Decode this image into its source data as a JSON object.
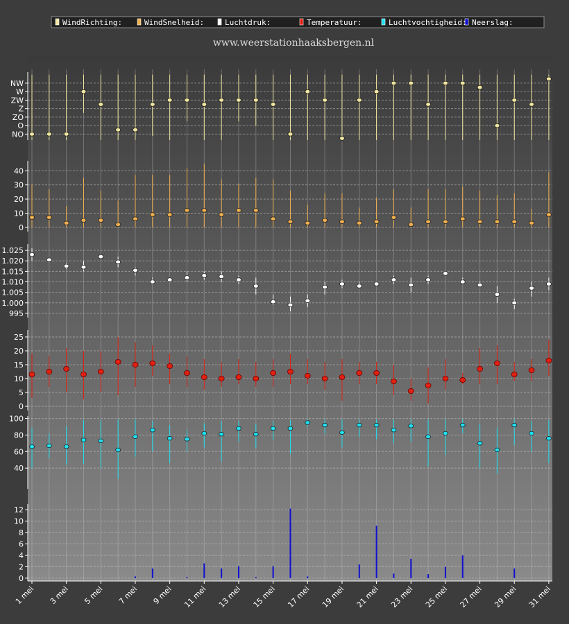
{
  "site_label": "www.weerstationhaaksbergen.nl",
  "legend": [
    {
      "label": "WindRichting:",
      "color": "#f0e6a0"
    },
    {
      "label": "WindSnelheid:",
      "color": "#f0b050"
    },
    {
      "label": "Luchtdruk:",
      "color": "#ffffff"
    },
    {
      "label": "Temperatuur:",
      "color": "#e02010"
    },
    {
      "label": "Luchtvochtigheid:",
      "color": "#20e0f0"
    },
    {
      "label": "Neerslag:",
      "color": "#1010d0"
    }
  ],
  "chart_data": [
    {
      "type": "scatter",
      "name": "WindRichting",
      "color": "#f0e6a0",
      "y_ticks": [
        "NO",
        "O",
        "ZO",
        "Z",
        "ZW",
        "W",
        "NW"
      ],
      "y_tick_values": [
        1,
        2,
        3,
        4,
        5,
        6,
        7
      ],
      "ylim": [
        0.3,
        8.3
      ],
      "x": [
        1,
        2,
        3,
        4,
        5,
        6,
        7,
        8,
        9,
        10,
        11,
        12,
        13,
        14,
        15,
        16,
        17,
        18,
        19,
        20,
        21,
        22,
        23,
        24,
        25,
        26,
        27,
        28,
        29,
        30,
        31
      ],
      "values": [
        1,
        1,
        1,
        6,
        4.5,
        1.5,
        1.5,
        4.5,
        5,
        5,
        4.5,
        5,
        5,
        5,
        4.5,
        1,
        6,
        5,
        0.5,
        5,
        6,
        7,
        7,
        4.5,
        7,
        7,
        6.5,
        2,
        5,
        4.5,
        7.5
      ],
      "low": [
        0.3,
        0.3,
        0.3,
        3.5,
        0.3,
        0.3,
        0.3,
        0.8,
        0.3,
        2.5,
        0.3,
        0.3,
        2.5,
        2,
        0.3,
        0.3,
        0.3,
        0.3,
        0.3,
        0.3,
        0.3,
        0.3,
        0.3,
        0.3,
        0.3,
        0.3,
        0.3,
        0.3,
        0.3,
        0.3,
        0.3
      ],
      "high": [
        8,
        8,
        8,
        8,
        8,
        8,
        8,
        8,
        8,
        8,
        8,
        8,
        8,
        8,
        8,
        8,
        8,
        8,
        8,
        8,
        8,
        8,
        8,
        8,
        8,
        8,
        8,
        8,
        8,
        8,
        8
      ]
    },
    {
      "type": "scatter",
      "name": "WindSnelheid",
      "color": "#f0b050",
      "y_ticks": [
        "0",
        "10",
        "20",
        "30",
        "40"
      ],
      "y_tick_values": [
        0,
        10,
        20,
        30,
        40
      ],
      "ylim": [
        -3,
        47
      ],
      "x": [
        1,
        2,
        3,
        4,
        5,
        6,
        7,
        8,
        9,
        10,
        11,
        12,
        13,
        14,
        15,
        16,
        17,
        18,
        19,
        20,
        21,
        22,
        23,
        24,
        25,
        26,
        27,
        28,
        29,
        30,
        31
      ],
      "values": [
        7,
        7,
        3,
        5,
        5,
        2,
        6,
        9,
        9,
        12,
        12,
        9,
        12,
        12,
        6,
        4,
        3,
        5,
        4,
        3,
        4,
        7,
        2,
        4,
        4,
        6,
        4,
        4,
        4,
        3,
        9
      ],
      "low": [
        0,
        0,
        0,
        0,
        0,
        0,
        0,
        0,
        0,
        0,
        0,
        0,
        0,
        0,
        0,
        0,
        0,
        0,
        0,
        0,
        0,
        0,
        0,
        0,
        0,
        0,
        0,
        0,
        0,
        0,
        0
      ],
      "high": [
        30,
        27,
        15,
        35,
        26,
        19,
        37,
        37,
        37,
        42,
        45,
        34,
        31,
        35,
        34,
        26,
        16,
        24,
        24,
        14,
        21,
        27,
        14,
        27,
        27,
        29,
        26,
        23,
        24,
        13,
        39
      ]
    },
    {
      "type": "scatter",
      "name": "Luchtdruk",
      "color": "#ffffff",
      "y_ticks": [
        "995",
        "1.000",
        "1.005",
        "1.010",
        "1.015",
        "1.020",
        "1.025"
      ],
      "y_tick_values": [
        995,
        1000,
        1005,
        1010,
        1015,
        1020,
        1025
      ],
      "ylim": [
        993,
        1028
      ],
      "x": [
        1,
        2,
        3,
        4,
        5,
        6,
        7,
        8,
        9,
        10,
        11,
        12,
        13,
        14,
        15,
        16,
        17,
        18,
        19,
        20,
        21,
        22,
        23,
        24,
        25,
        26,
        27,
        28,
        29,
        30,
        31
      ],
      "values": [
        1023,
        1020.5,
        1017.5,
        1017,
        1022,
        1019.5,
        1015.5,
        1010,
        1011,
        1012,
        1013,
        1012.5,
        1011,
        1008,
        1000.5,
        999,
        1001,
        1007.5,
        1009,
        1008,
        1009,
        1011,
        1008.5,
        1011,
        1014,
        1010,
        1008.5,
        1004,
        1000,
        1007,
        1009
      ],
      "low": [
        1020,
        1020,
        1016,
        1015,
        1021,
        1017,
        1013,
        1009,
        1010,
        1010,
        1011,
        1010,
        1009,
        1004,
        999,
        996,
        998,
        1004,
        1007,
        1007,
        1008,
        1009,
        1005,
        1009,
        1013,
        1009,
        1008,
        1000,
        997,
        1003,
        1006
      ],
      "high": [
        1026,
        1021,
        1019,
        1020,
        1023,
        1022,
        1017,
        1012,
        1012,
        1015,
        1015,
        1015,
        1013,
        1012,
        1004,
        1003,
        1004,
        1010,
        1011,
        1010,
        1010,
        1013,
        1012,
        1013,
        1015,
        1012,
        1010,
        1008,
        1002,
        1010,
        1012
      ]
    },
    {
      "type": "scatter",
      "name": "Temperatuur",
      "color": "#e02010",
      "y_ticks": [
        "0",
        "5",
        "10",
        "15",
        "20",
        "25"
      ],
      "y_tick_values": [
        0,
        5,
        10,
        15,
        20,
        25
      ],
      "ylim": [
        -1.5,
        27.5
      ],
      "x": [
        1,
        2,
        3,
        4,
        5,
        6,
        7,
        8,
        9,
        10,
        11,
        12,
        13,
        14,
        15,
        16,
        17,
        18,
        19,
        20,
        21,
        22,
        23,
        24,
        25,
        26,
        27,
        28,
        29,
        30,
        31
      ],
      "values": [
        11.5,
        12.5,
        13.5,
        11.5,
        12.5,
        16,
        15,
        15.5,
        14.5,
        12,
        10.5,
        10,
        10.5,
        10,
        12,
        12.5,
        11,
        10,
        10.5,
        12,
        12,
        9,
        5.5,
        7.5,
        10,
        9.5,
        13.5,
        15.5,
        11.5,
        13,
        16.5
      ],
      "low": [
        3,
        7,
        5,
        2.5,
        5,
        4,
        7,
        11,
        8,
        7,
        6,
        7,
        8,
        7,
        7,
        8,
        8,
        6,
        2,
        8,
        8,
        4,
        2,
        1,
        6,
        8,
        8,
        8,
        9,
        9,
        11
      ],
      "high": [
        19,
        18,
        21,
        20,
        20,
        25,
        23,
        22,
        19,
        18,
        17,
        16,
        17,
        16,
        17,
        19,
        17,
        16,
        17,
        16,
        16,
        15,
        10,
        14,
        17,
        12,
        21,
        22,
        16,
        17,
        24
      ]
    },
    {
      "type": "scatter",
      "name": "Luchtvochtigheid",
      "color": "#20e0f0",
      "y_ticks": [
        "40",
        "60",
        "80",
        "100"
      ],
      "y_tick_values": [
        40,
        60,
        80,
        100
      ],
      "ylim": [
        15,
        103
      ],
      "x": [
        1,
        2,
        3,
        4,
        5,
        6,
        7,
        8,
        9,
        10,
        11,
        12,
        13,
        14,
        15,
        16,
        17,
        18,
        19,
        20,
        21,
        22,
        23,
        24,
        25,
        26,
        27,
        28,
        29,
        30,
        31
      ],
      "values": [
        66,
        67,
        66,
        74,
        73,
        62,
        78,
        86,
        76,
        75,
        82,
        81,
        88,
        81,
        88,
        88,
        95,
        92,
        83,
        92,
        92,
        86,
        91,
        78,
        82,
        92,
        70,
        62,
        92,
        82,
        76
      ],
      "low": [
        40,
        52,
        44,
        45,
        40,
        27,
        54,
        60,
        46,
        60,
        65,
        48,
        72,
        64,
        74,
        57,
        90,
        82,
        65,
        78,
        75,
        70,
        72,
        42,
        56,
        82,
        40,
        33,
        68,
        60,
        46
      ],
      "high": [
        89,
        82,
        91,
        98,
        98,
        99,
        99,
        97,
        92,
        86,
        94,
        97,
        97,
        93,
        97,
        98,
        99,
        99,
        99,
        99,
        99,
        99,
        99,
        99,
        99,
        99,
        93,
        89,
        99,
        97,
        98
      ]
    },
    {
      "type": "bar",
      "name": "Neerslag",
      "color": "#1010d0",
      "y_ticks": [
        "0",
        "2",
        "4",
        "6",
        "8",
        "10",
        "12"
      ],
      "y_tick_values": [
        0,
        2,
        4,
        6,
        8,
        10,
        12
      ],
      "ylim": [
        -0.5,
        13
      ],
      "x": [
        1,
        2,
        3,
        4,
        5,
        6,
        7,
        8,
        9,
        10,
        11,
        12,
        13,
        14,
        15,
        16,
        17,
        18,
        19,
        20,
        21,
        22,
        23,
        24,
        25,
        26,
        27,
        28,
        29,
        30,
        31
      ],
      "values": [
        0,
        0,
        0,
        0,
        0,
        0,
        0.3,
        1.7,
        0,
        0.2,
        2.6,
        1.7,
        2.1,
        0.2,
        2.1,
        12.2,
        0.3,
        0,
        0,
        2.4,
        9.2,
        0.8,
        3.4,
        0.7,
        2,
        4,
        0,
        0,
        1.7,
        0,
        0
      ]
    }
  ],
  "x_axis": {
    "ticks": [
      "1 mei",
      "3 mei",
      "5 mei",
      "7 mei",
      "9 mei",
      "11 mei",
      "13 mei",
      "15 mei",
      "17 mei",
      "19 mei",
      "21 mei",
      "23 mei",
      "25 mei",
      "27 mei",
      "29 mei",
      "31 mei"
    ],
    "tick_days": [
      1,
      3,
      5,
      7,
      9,
      11,
      13,
      15,
      17,
      19,
      21,
      23,
      25,
      27,
      29,
      31
    ]
  }
}
